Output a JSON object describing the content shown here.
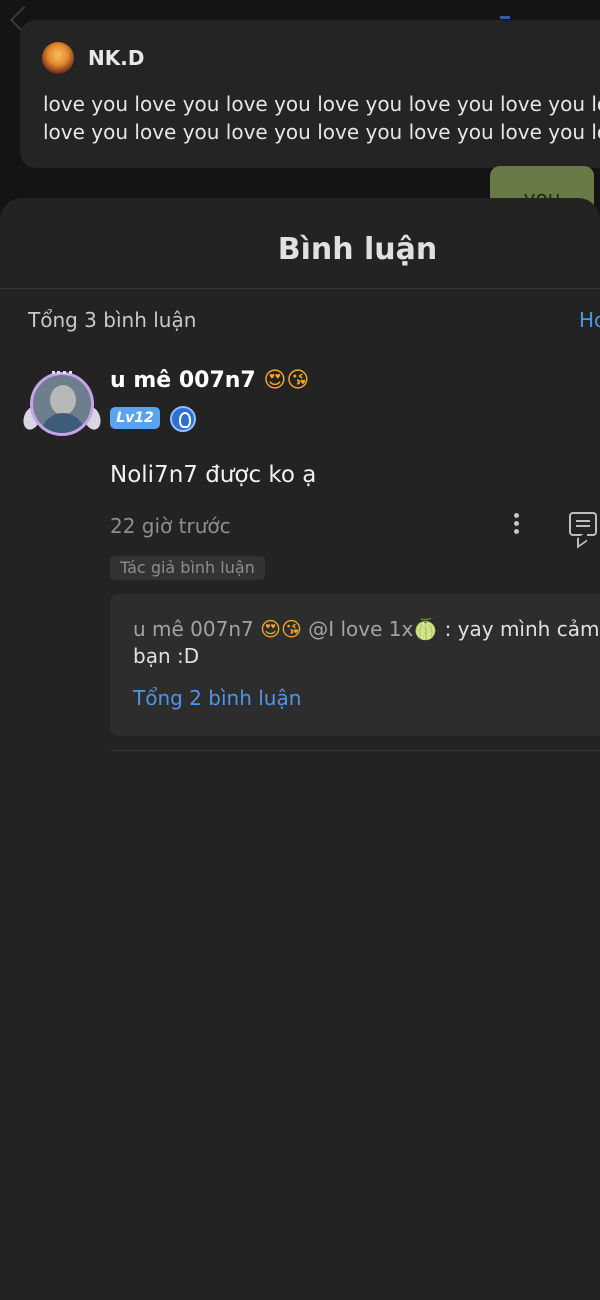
{
  "post": {
    "author": "NK.D",
    "text_line1": "love you love you love you love you love you love you love",
    "text_line2": "love you love you love you love you love you love you love",
    "you_button_label": "you"
  },
  "sheet": {
    "title": "Bình luận",
    "total_count": "Tổng 3 bình luận",
    "sort_label": "Ho"
  },
  "comment": {
    "name": "u mê 007n7",
    "name_emojis": "😍😘",
    "level": "Lv12",
    "text": "Noli7n7 được ko ạ",
    "time": "22 giờ trước",
    "author_tag": "Tác giả bình luận",
    "reply": {
      "name": "u mê 007n7",
      "name_emojis": "😍😘",
      "mention": "@I love 1x",
      "mention_emoji": "🍈",
      "text_part": ": yay mình cảm",
      "text_line2": "bạn :D",
      "total_replies": "Tổng 2 bình luận"
    }
  },
  "colors": {
    "accent_blue": "#4f95e6",
    "level_badge": "#5aa3ee",
    "sheet_bg": "#232323",
    "you_button": "#6a7a47"
  }
}
